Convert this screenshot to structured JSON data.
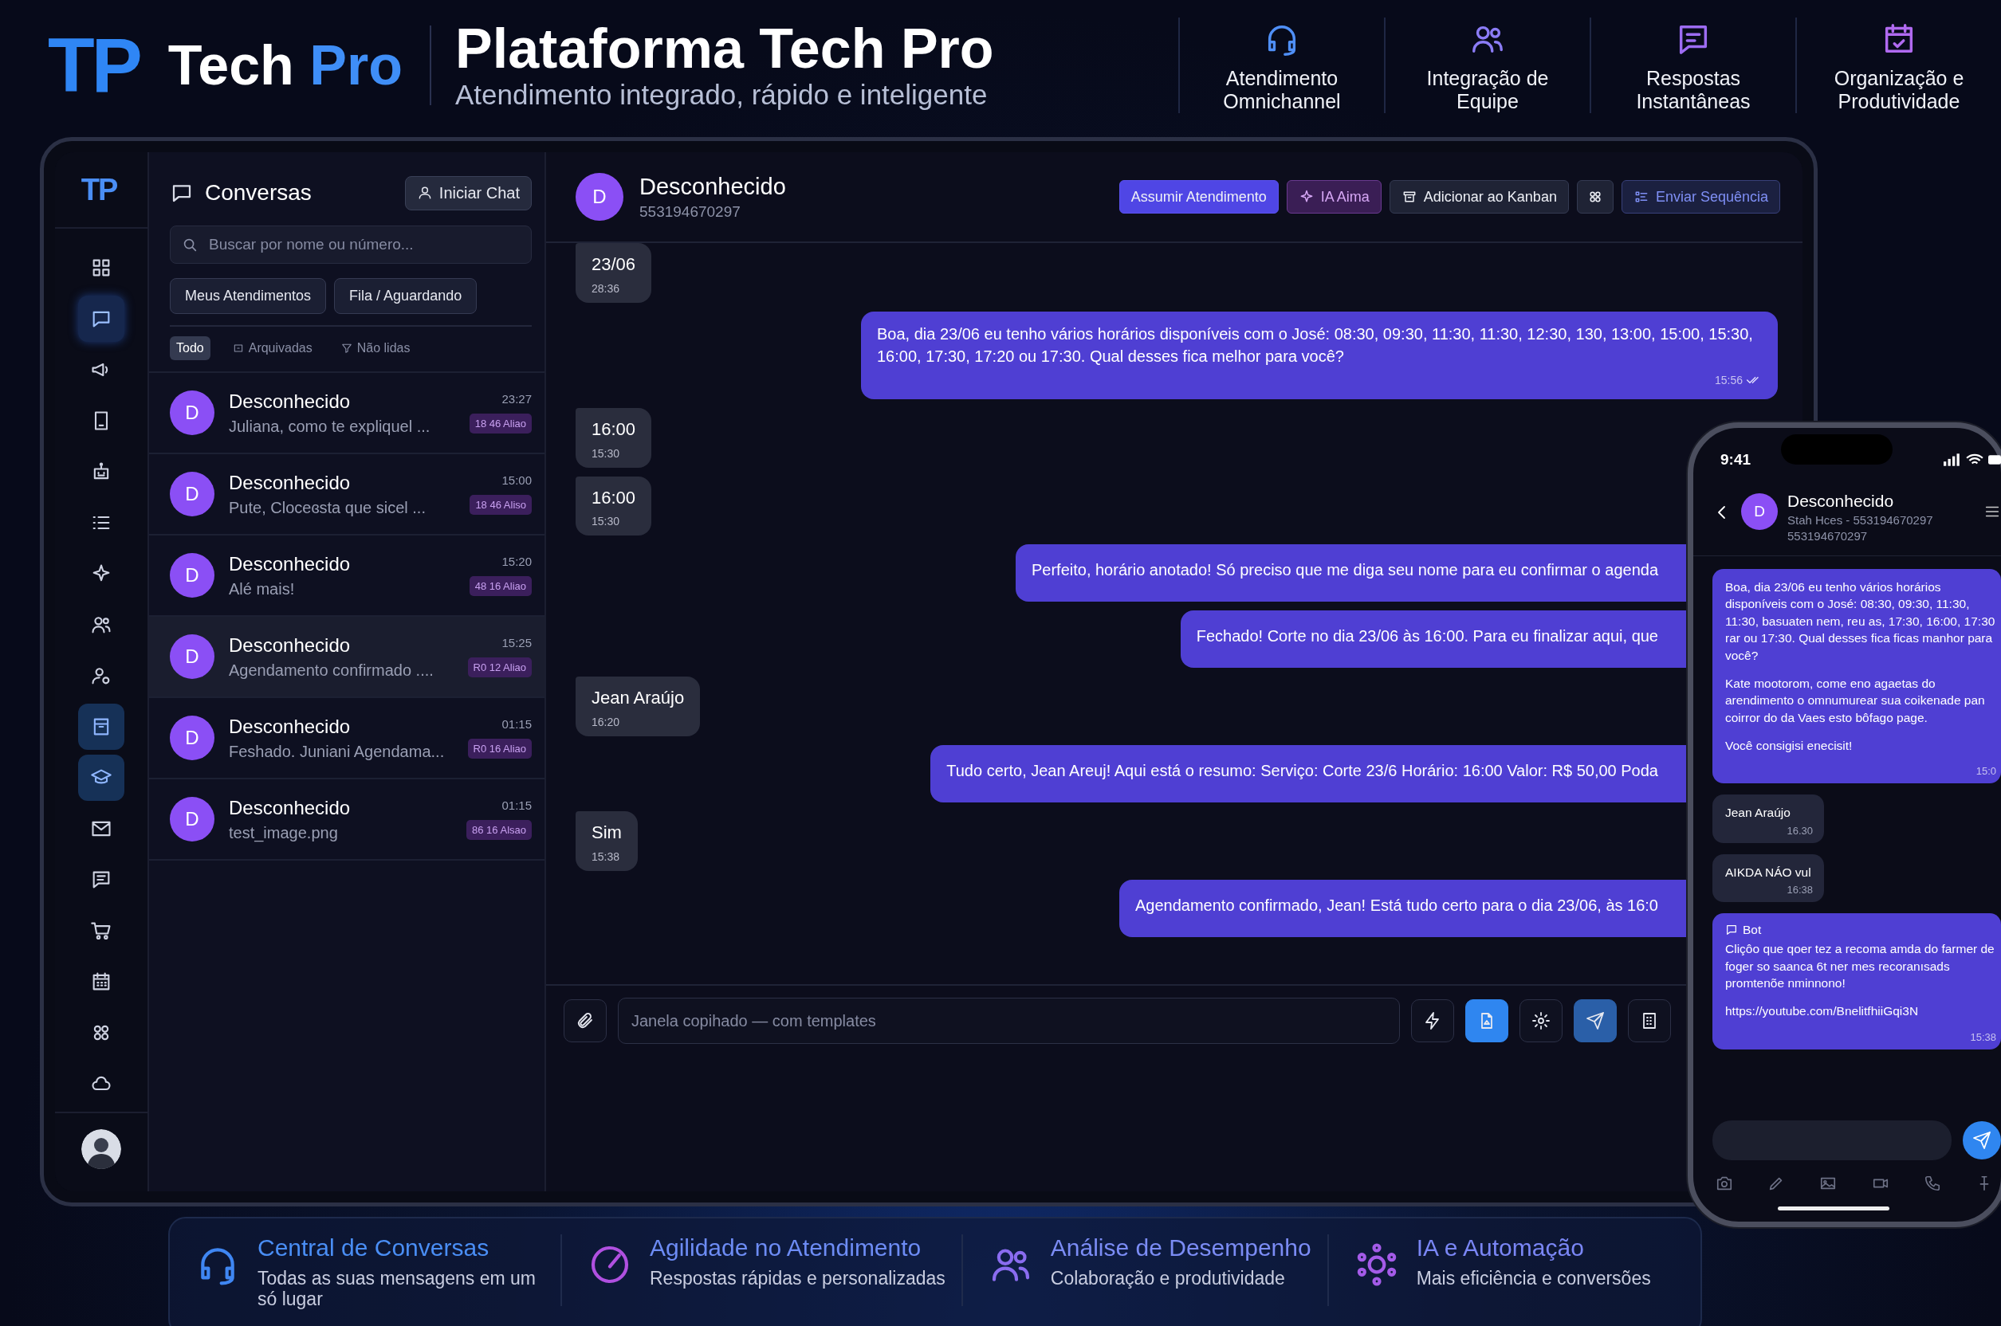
{
  "header": {
    "logo_mark": "TP",
    "brand": "Tech",
    "brand_accent": "Pro",
    "title": "Plataforma Tech Pro",
    "subtitle": "Atendimento integrado, rápido e inteligente",
    "features": [
      {
        "lines": [
          "Atendimento",
          "Omnichannel"
        ]
      },
      {
        "lines": [
          "Integração de",
          "Equipe"
        ]
      },
      {
        "lines": [
          "Respostas",
          "Instantâneas"
        ]
      },
      {
        "lines": [
          "Organização e",
          "Produtividade"
        ]
      }
    ]
  },
  "app": {
    "sidebar": {
      "logo_mark": "TP",
      "items": [
        {
          "selected": false,
          "highlighted": false
        },
        {
          "selected": true,
          "highlighted": false
        },
        {
          "selected": false,
          "highlighted": false
        },
        {
          "selected": false,
          "highlighted": false
        },
        {
          "selected": false,
          "highlighted": false
        },
        {
          "selected": false,
          "highlighted": false
        },
        {
          "selected": false,
          "highlighted": false
        },
        {
          "selected": false,
          "highlighted": false
        },
        {
          "selected": false,
          "highlighted": false
        },
        {
          "selected": false,
          "highlighted": true
        },
        {
          "selected": false,
          "highlighted": true
        },
        {
          "selected": false,
          "highlighted": false
        },
        {
          "selected": false,
          "highlighted": false
        },
        {
          "selected": false,
          "highlighted": false
        },
        {
          "selected": false,
          "highlighted": false
        },
        {
          "selected": false,
          "highlighted": false
        },
        {
          "selected": false,
          "highlighted": false
        }
      ]
    },
    "conversations": {
      "title": "Conversas",
      "new_chat_button": "Iniciar Chat",
      "search": {
        "placeholder": "Buscar por nome ou número..."
      },
      "queues": [
        {
          "label": "Meus Atendimentos"
        },
        {
          "label": "Fila / Aguardando"
        }
      ],
      "filters": [
        {
          "label": "Todo",
          "selected": true
        },
        {
          "label": "Arquivadas",
          "selected": false
        },
        {
          "label": "Não lidas",
          "selected": false
        }
      ],
      "items": [
        {
          "avatar": "D",
          "name": "Desconhecido",
          "preview": "Juliana, como te expliquel ...",
          "time": "23:27",
          "tag": "18 46 Aliao",
          "selected": false
        },
        {
          "avatar": "D",
          "name": "Desconhecido",
          "preview": "Pute, Cloceɞsta que sicel ...",
          "time": "15:00",
          "tag": "18 46 Aliso",
          "selected": false
        },
        {
          "avatar": "D",
          "name": "Desconhecido",
          "preview": "Alé mais!",
          "time": "15:20",
          "tag": "48 16 Aliao",
          "selected": false
        },
        {
          "avatar": "D",
          "name": "Desconhecido",
          "preview": "Agendamento confirmado ....",
          "time": "15:25",
          "tag": "R0 12 Aliao",
          "selected": true
        },
        {
          "avatar": "D",
          "name": "Desconhecido",
          "preview": "Feshado. Juniani Agendama...",
          "time": "01:15",
          "tag": "R0 16 Aliao",
          "selected": false
        },
        {
          "avatar": "D",
          "name": "Desconhecido",
          "preview": "test_image.png",
          "time": "01:15",
          "tag": "86 16 Alsao",
          "selected": false
        }
      ]
    },
    "chat": {
      "contact": {
        "avatar": "D",
        "name": "Desconhecido",
        "phone": "553194670297"
      },
      "actions": [
        {
          "kind": "primary",
          "label": "Assumir Atendimento"
        },
        {
          "kind": "ai",
          "label": "IA Aima"
        },
        {
          "kind": "default",
          "label": "Adicionar ao Kanban"
        },
        {
          "kind": "icon"
        },
        {
          "kind": "outline",
          "label": "Enviar Sequência"
        }
      ],
      "messages": [
        {
          "kind": "in",
          "text": "23/06",
          "time": "28:36"
        },
        {
          "kind": "out",
          "text": "Boa, dia 23/06 eu tenho vários horários disponíveis com o José: 08:30, 09:30, 11:30, 11:30, 12:30, 130, 13:00, 15:00, 15:30, 16:00, 17:30, 17:20 ou 17:30. Qual desses fica melhor para você?",
          "time": "15:56",
          "read": true
        },
        {
          "kind": "in",
          "text": "16:00",
          "time": "15:30"
        },
        {
          "kind": "in",
          "text": "16:00",
          "time": "15:30"
        },
        {
          "kind": "out",
          "text": "Perfeito, horário anotado! Só preciso que me diga seu nome para eu confirmar o agenda"
        },
        {
          "kind": "out",
          "text": "Fechado! Corte no dia 23/06 às 16:00. Para eu finalizar aqui, que"
        },
        {
          "kind": "in",
          "text": "Jean Araújo",
          "time": "16:20"
        },
        {
          "kind": "out",
          "text": "Tudo certo, Jean Areuj! Aqui está o resumo: Serviço: Corte 23/6 Horário: 16:00 Valor: R$ 50,00 Poda"
        },
        {
          "kind": "in",
          "text": "Sim",
          "time": "15:38"
        },
        {
          "kind": "out",
          "text": "Agendamento confirmado, Jean! Está tudo certo para o dia 23/06, às 16:0"
        }
      ],
      "composer": {
        "placeholder": "Janela copihado — com templates"
      }
    }
  },
  "phone": {
    "time": "9:41",
    "contact": {
      "avatar": "D",
      "name": "Desconhecido",
      "status": "Stah Hces - 553194670297",
      "phone": "553194670297"
    },
    "messages": [
      {
        "kind": "out",
        "paragraphs": [
          "Boa, dia 23/06 eu tenho vários horários disponíveis com o José: 08:30, 09:30, 11:30, 11:30, basuaten nem, reu as, 17:30, 16:00, 17:30 rar ou 17:30. Qual desses fica ficas manhor para você?",
          "Kate mootorom, come eno agaetas do arendimento o omnumurear sua coikenade pan coirror do da Vaes esto bôfago page.",
          "Você consigisi enecisit!"
        ],
        "time": "15:0"
      },
      {
        "kind": "in",
        "paragraphs": [
          "Jean Araújo"
        ],
        "time": "16.30"
      },
      {
        "kind": "in",
        "paragraphs": [
          "AIKDA NÁO vul"
        ],
        "time": "16:38"
      },
      {
        "kind": "bot",
        "label": "Bot",
        "paragraphs": [
          "Cliçôo que qoer tez a recoma amda do farmer de foger so saanca 6t ner mes recoranısads promtenõe nminnono!",
          "https://youtube.com/BnelitfhiiGqi3N"
        ],
        "time": "15:38"
      }
    ]
  },
  "highlights": [
    {
      "title": "Central de Conversas",
      "text": "Todas as suas mensagens em um só lugar"
    },
    {
      "title": "Agilidade no Atendimento",
      "text": "Respostas rápidas e personalizadas"
    },
    {
      "title": "Análise de Desempenho",
      "text": "Colaboração e produtividade"
    },
    {
      "title": "IA e Automação",
      "text": "Mais eficiência e conversões"
    }
  ]
}
